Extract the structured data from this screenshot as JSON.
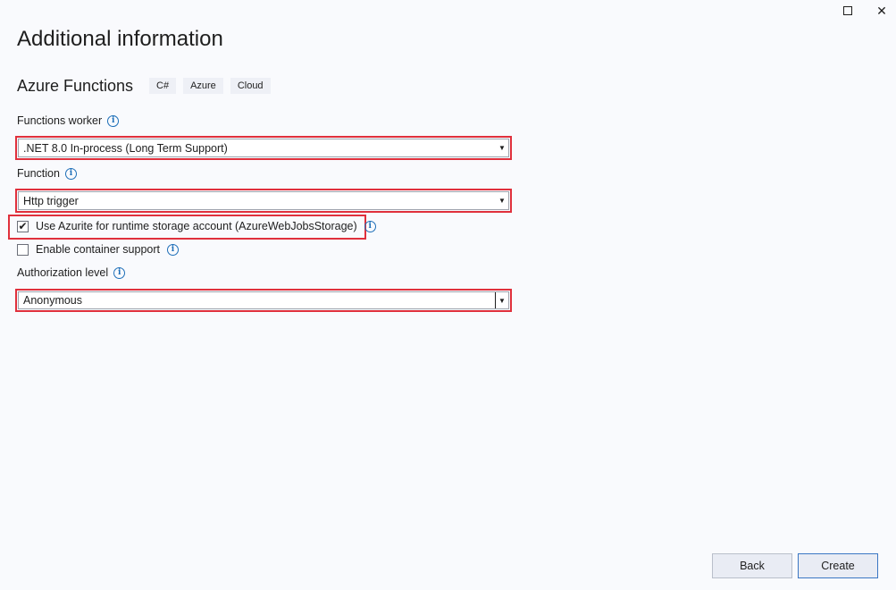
{
  "window": {
    "maximize_icon": "maximize-icon",
    "close_icon": "close-icon",
    "close_glyph": "✕"
  },
  "page_title": "Additional information",
  "template": {
    "name": "Azure Functions",
    "tags": [
      "C#",
      "Azure",
      "Cloud"
    ]
  },
  "fields": {
    "functions_worker": {
      "label": "Functions worker",
      "value": ".NET 8.0 In-process (Long Term Support)"
    },
    "function": {
      "label": "Function",
      "value": "Http trigger"
    },
    "use_azurite": {
      "label": "Use Azurite for runtime storage account (AzureWebJobsStorage)",
      "checked": true,
      "check_glyph": "✔"
    },
    "container_support": {
      "label": "Enable container support",
      "checked": false
    },
    "authorization_level": {
      "label": "Authorization level",
      "value": "Anonymous"
    }
  },
  "info_glyph": "i",
  "dropdown_arrow": "▼",
  "buttons": {
    "back": "Back",
    "create": "Create"
  },
  "colors": {
    "highlight": "#e0303c",
    "info": "#1e6fb8",
    "primary_border": "#3b77c4"
  }
}
